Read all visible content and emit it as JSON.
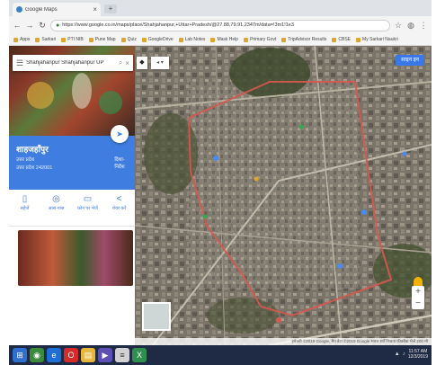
{
  "browser": {
    "tab_title": "Google Maps",
    "url": "https://www.google.co.in/maps/place/Shahjahanpur,+Uttar+Pradesh/@27.88,79.91,2347m/data=!3m1!1e3",
    "bookmarks": [
      "Apps",
      "Sarkari",
      "PTI NIB",
      "Pune Map",
      "Quiz",
      "GoogleDrive",
      "Lab Notes",
      "Mask Help",
      "Primary Govt",
      "TripAdvisor Results",
      "CBSE",
      "My Sarkari Naukri"
    ]
  },
  "search": {
    "query": "Shahjahanpur Shahjahanpur UP"
  },
  "place": {
    "name": "शाहजहाँपुर",
    "subtitle": "उत्तर प्रदेश",
    "subtitle2": "उत्तर प्रदेश 242001",
    "directions_label": "दिशा-निर्देश"
  },
  "actions": [
    {
      "icon": "save-icon",
      "label": "सहेजें"
    },
    {
      "icon": "nearby-icon",
      "label": "आस-पास"
    },
    {
      "icon": "phone-icon",
      "label": "फ़ोन पर भेजें"
    },
    {
      "icon": "share-icon",
      "label": "शेयर करें"
    }
  ],
  "map": {
    "signin_label": "साइन इन",
    "footer": "इमेजरी ©2019 Google, मैप डेटा ©2019 Google  भारत  शर्तें  निजता  फ़ीडबैक भेजें  200 मी"
  },
  "taskbar": {
    "time": "11:57 AM",
    "date": "12/3/2019"
  },
  "colors": {
    "accent": "#3f7de0",
    "boundary": "#d9574f",
    "taskbar": "#1f2a44"
  }
}
